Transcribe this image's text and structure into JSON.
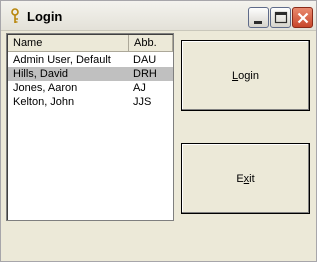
{
  "window": {
    "title": "Login",
    "title_icon": "key-icon",
    "controls": {
      "minimize": "minimize-icon",
      "maximize": "maximize-icon",
      "close": "close-icon"
    }
  },
  "user_list": {
    "columns": [
      "Name",
      "Abb."
    ],
    "rows": [
      {
        "name": "Admin User, Default",
        "abb": "DAU"
      },
      {
        "name": "Hills, David",
        "abb": "DRH",
        "selected": true
      },
      {
        "name": "Jones, Aaron",
        "abb": "AJ"
      },
      {
        "name": "Kelton, John",
        "abb": "JJS"
      }
    ]
  },
  "buttons": {
    "login": {
      "label_pre": "",
      "label_mnemonic": "L",
      "label_post": "ogin"
    },
    "exit": {
      "label_pre": "E",
      "label_mnemonic": "x",
      "label_post": "it"
    }
  },
  "colors": {
    "face": "#ece9d8",
    "selection": "#c0c0c0"
  }
}
